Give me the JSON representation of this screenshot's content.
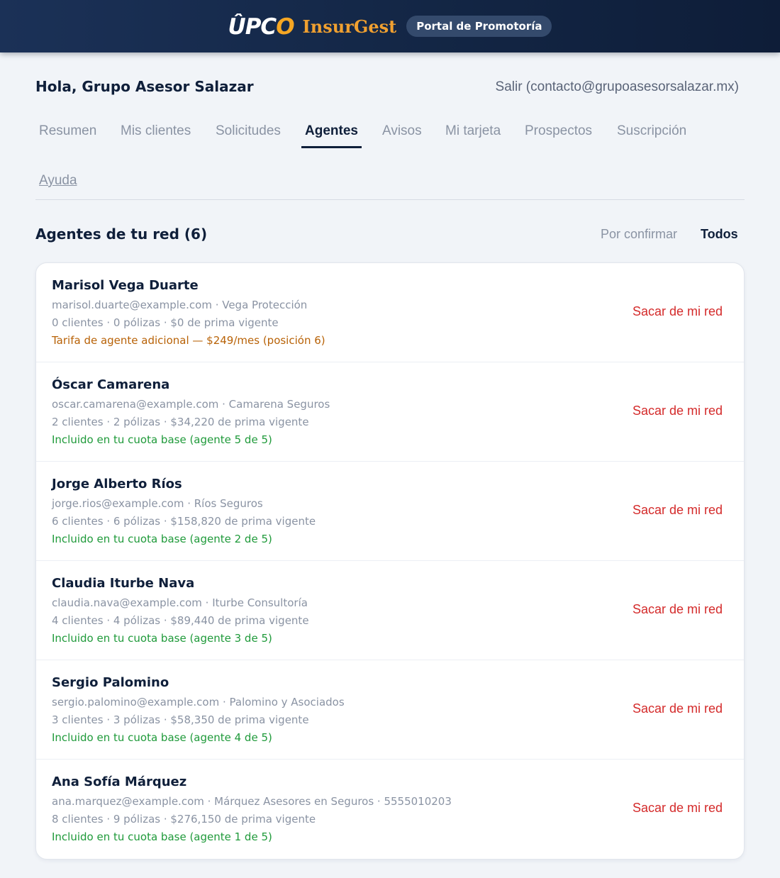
{
  "header": {
    "logo_prefix": "ÛPC",
    "logo_o": "O",
    "app_name": "InsurGest",
    "portal_label": "Portal de Promotoría"
  },
  "user": {
    "greeting": "Hola, Grupo Asesor Salazar",
    "logout": "Salir (contacto@grupoasesorsalazar.mx)"
  },
  "nav": {
    "tabs": [
      {
        "label": "Resumen"
      },
      {
        "label": "Mis clientes"
      },
      {
        "label": "Solicitudes"
      },
      {
        "label": "Agentes",
        "active": true
      },
      {
        "label": "Avisos"
      },
      {
        "label": "Mi tarjeta"
      },
      {
        "label": "Prospectos"
      },
      {
        "label": "Suscripción"
      },
      {
        "label": "Ayuda"
      }
    ]
  },
  "section": {
    "title": "Agentes de tu red (6)",
    "filters": [
      {
        "label": "Por confirmar"
      },
      {
        "label": "Todos",
        "active": true
      }
    ]
  },
  "agents": [
    {
      "name": "Marisol Vega Duarte",
      "contact": "marisol.duarte@example.com · Vega Protección",
      "stats": "0 clientes · 0 pólizas · $0 de prima vigente",
      "billing": "Tarifa de agente adicional — $249/mes (posición 6)",
      "billing_type": "extra",
      "action": "Sacar de mi red"
    },
    {
      "name": "Óscar Camarena",
      "contact": "oscar.camarena@example.com · Camarena Seguros",
      "stats": "2 clientes · 2 pólizas · $34,220 de prima vigente",
      "billing": "Incluido en tu cuota base (agente 5 de 5)",
      "billing_type": "included",
      "action": "Sacar de mi red"
    },
    {
      "name": "Jorge Alberto Ríos",
      "contact": "jorge.rios@example.com · Ríos Seguros",
      "stats": "6 clientes · 6 pólizas · $158,820 de prima vigente",
      "billing": "Incluido en tu cuota base (agente 2 de 5)",
      "billing_type": "included",
      "action": "Sacar de mi red"
    },
    {
      "name": "Claudia Iturbe Nava",
      "contact": "claudia.nava@example.com · Iturbe Consultoría",
      "stats": "4 clientes · 4 pólizas · $89,440 de prima vigente",
      "billing": "Incluido en tu cuota base (agente 3 de 5)",
      "billing_type": "included",
      "action": "Sacar de mi red"
    },
    {
      "name": "Sergio Palomino",
      "contact": "sergio.palomino@example.com · Palomino y Asociados",
      "stats": "3 clientes · 3 pólizas · $58,350 de prima vigente",
      "billing": "Incluido en tu cuota base (agente 4 de 5)",
      "billing_type": "included",
      "action": "Sacar de mi red"
    },
    {
      "name": "Ana Sofía Márquez",
      "contact": "ana.marquez@example.com · Márquez Asesores en Seguros · 5555010203",
      "stats": "8 clientes · 9 pólizas · $276,150 de prima vigente",
      "billing": "Incluido en tu cuota base (agente 1 de 5)",
      "billing_type": "included",
      "action": "Sacar de mi red"
    }
  ],
  "colors": {
    "header_bg": "#132645",
    "brand_orange": "#f0a030",
    "navy_text": "#0f1f3a",
    "muted_text": "#8a93a3",
    "danger": "#d42a2a",
    "included_green": "#1f9a3a",
    "extra_orange": "#b86207"
  }
}
